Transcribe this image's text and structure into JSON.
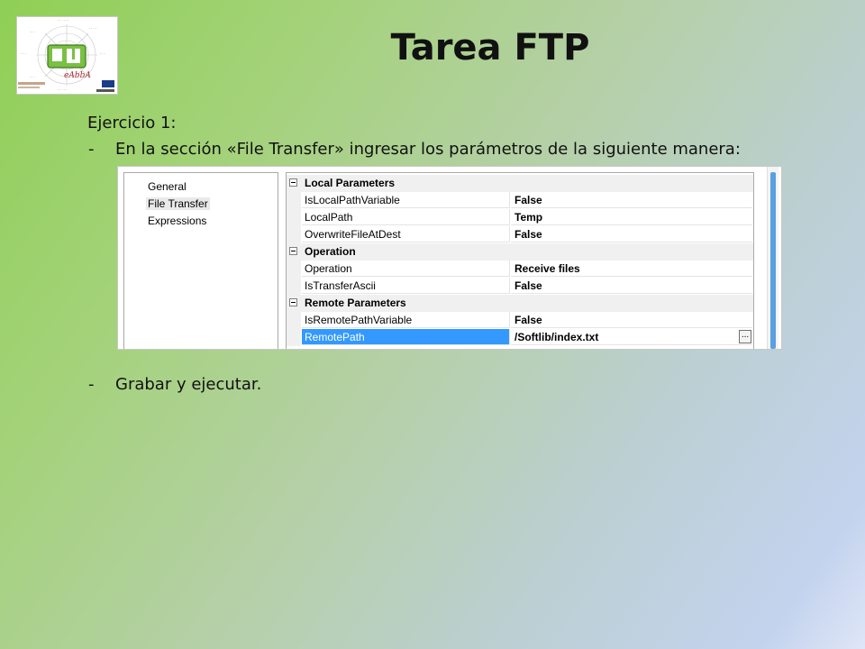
{
  "slide": {
    "title": "Tarea FTP",
    "exercise_heading": "Ejercicio 1:",
    "bullet_dash": "-",
    "instruction": "En la sección «File Transfer» ingresar los parámetros de la siguiente manera:",
    "final_step": "Grabar y ejecutar."
  },
  "logo": {
    "text": "eAbbA",
    "icon": "radar-chart-logo-icon"
  },
  "dialog": {
    "nav_items": [
      "General",
      "File Transfer",
      "Expressions"
    ],
    "selected_nav": "File Transfer",
    "categories": [
      {
        "label": "Local Parameters",
        "properties": [
          {
            "name": "IsLocalPathVariable",
            "value": "False"
          },
          {
            "name": "LocalPath",
            "value": "Temp"
          },
          {
            "name": "OverwriteFileAtDest",
            "value": "False"
          }
        ]
      },
      {
        "label": "Operation",
        "properties": [
          {
            "name": "Operation",
            "value": "Receive files"
          },
          {
            "name": "IsTransferAscii",
            "value": "False"
          }
        ]
      },
      {
        "label": "Remote Parameters",
        "properties": [
          {
            "name": "IsRemotePathVariable",
            "value": "False"
          },
          {
            "name": "RemotePath",
            "value": "/Softlib/index.txt"
          }
        ]
      }
    ],
    "selected_property": "RemotePath",
    "ellipsis_label": "...",
    "colors": {
      "selection": "#3399ff",
      "category_bg": "#f0f0f0",
      "scroll_thumb": "#5aa0e0"
    }
  }
}
